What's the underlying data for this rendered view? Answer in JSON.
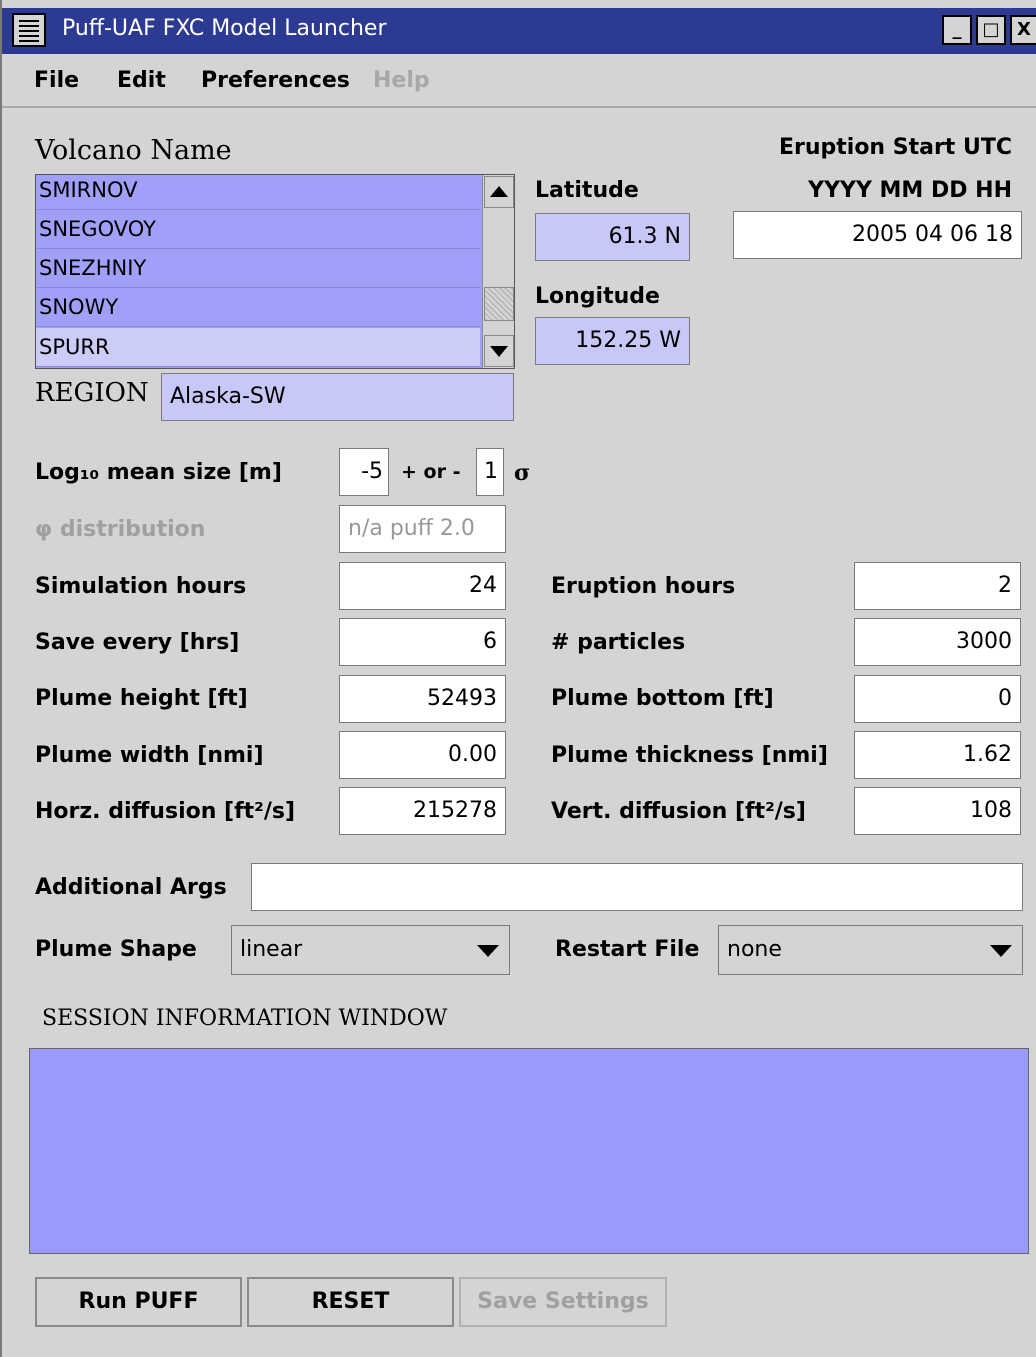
{
  "window": {
    "title": "Puff-UAF FXC Model Launcher",
    "minimize": "_",
    "maximize": "□",
    "close": "X"
  },
  "menu": {
    "file": "File",
    "edit": "Edit",
    "preferences": "Preferences",
    "help": "Help"
  },
  "volcano": {
    "label": "Volcano Name",
    "items": [
      "SMIRNOV",
      "SNEGOVOY",
      "SNEZHNIY",
      "SNOWY",
      "SPURR"
    ],
    "selected": "SPURR",
    "region_label": "REGION",
    "region_value": "Alaska-SW"
  },
  "location": {
    "lat_label": "Latitude",
    "lat_value": "61.3 N",
    "lon_label": "Longitude",
    "lon_value": "152.25 W"
  },
  "eruption_start": {
    "label": "Eruption Start UTC",
    "format": "YYYY MM DD HH",
    "value": "2005 04 06 18"
  },
  "params": {
    "log_mean_label": "Log₁₀ mean size [m]",
    "log_mean_value": "-5",
    "plus_minus_label": "+ or -",
    "sigma_value": "1",
    "sigma_symbol": "σ",
    "phi_label": "φ distribution",
    "phi_value": "n/a puff 2.0",
    "sim_hours_label": "Simulation hours",
    "sim_hours_value": "24",
    "save_every_label": "Save every [hrs]",
    "save_every_value": "6",
    "plume_height_label": "Plume height [ft]",
    "plume_height_value": "52493",
    "plume_width_label": "Plume width [nmi]",
    "plume_width_value": "0.00",
    "horz_diff_label": "Horz. diffusion [ft²/s]",
    "horz_diff_value": "215278",
    "eruption_hours_label": "Eruption hours",
    "eruption_hours_value": "2",
    "particles_label": "# particles",
    "particles_value": "3000",
    "plume_bottom_label": "Plume bottom [ft]",
    "plume_bottom_value": "0",
    "plume_thickness_label": "Plume thickness [nmi]",
    "plume_thickness_value": "1.62",
    "vert_diff_label": "Vert. diffusion [ft²/s]",
    "vert_diff_value": "108"
  },
  "additional_args": {
    "label": "Additional Args",
    "value": ""
  },
  "plume_shape": {
    "label": "Plume Shape",
    "value": "linear"
  },
  "restart_file": {
    "label": "Restart File",
    "value": "none"
  },
  "session": {
    "label": "SESSION INFORMATION WINDOW",
    "content": ""
  },
  "buttons": {
    "run": "Run PUFF",
    "reset": "RESET",
    "save": "Save Settings"
  }
}
